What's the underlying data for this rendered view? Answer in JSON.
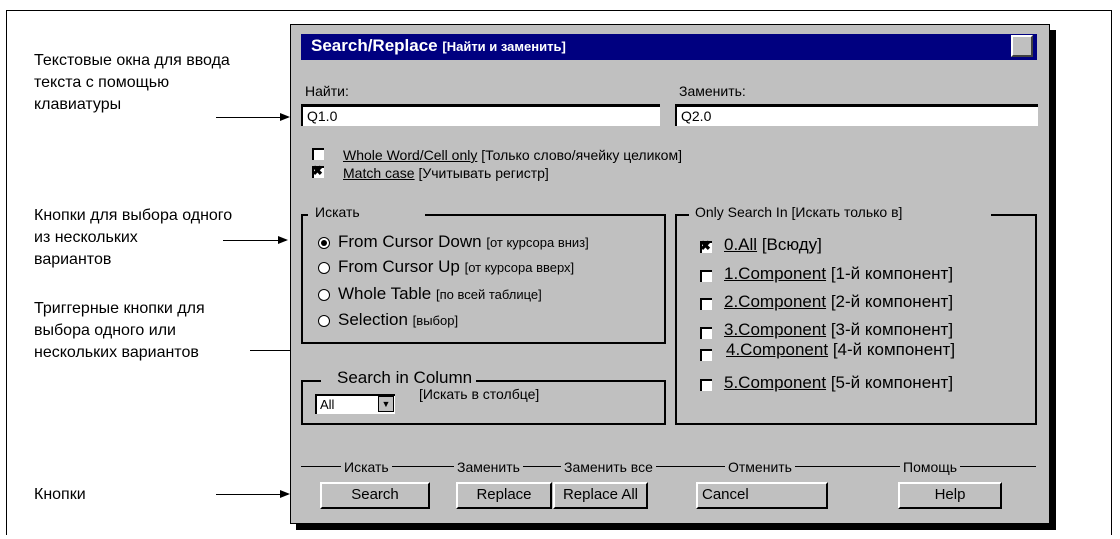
{
  "annotations": {
    "text_fields": "Текстовые окна для ввода\nтекста с помощью\nклавиатуры",
    "radio_buttons": "Кнопки для выбора одного\nиз нескольких\nвариантов",
    "check_buttons": "Триггерные кнопки для\nвыбора одного или\nнескольких вариантов",
    "buttons": "Кнопки"
  },
  "dialog": {
    "title": "Search/Replace",
    "title_ru": "[Найти и заменить]",
    "find_label": "Найти:",
    "find_value": "Q1.0",
    "replace_label": "Заменить:",
    "replace_value": "Q2.0",
    "whole_word": {
      "label": "Whole Word/Cell only",
      "ru": "[Только слово/ячейку целиком]",
      "checked": false
    },
    "match_case": {
      "label": "Match case",
      "ru": "[Учитывать регистр]",
      "checked": true
    },
    "search_group": {
      "legend": "Искать",
      "options": [
        {
          "label": "From Cursor Down",
          "ru": "[от курсора вниз]",
          "selected": true
        },
        {
          "label": "From Cursor Up",
          "ru": "[от курсора вверх]",
          "selected": false
        },
        {
          "label": "Whole Table",
          "ru": "[по всей таблице]",
          "selected": false
        },
        {
          "label": "Selection",
          "ru": "[выбор]",
          "selected": false
        }
      ]
    },
    "column_group": {
      "legend": "Search in Column",
      "ru": "[Искать в столбце]",
      "selected": "All"
    },
    "only_group": {
      "legend": "Only Search In [Искать только в]",
      "items": [
        {
          "label": "0.All",
          "ru": "[Всюду]",
          "checked": true
        },
        {
          "label": "1.Component",
          "ru": "[1-й компонент]",
          "checked": false
        },
        {
          "label": "2.Component",
          "ru": "[2-й компонент]",
          "checked": false
        },
        {
          "label": "3.Component",
          "ru": "[3-й компонент]",
          "checked": false
        },
        {
          "label": "4.Component",
          "ru": "[4-й компонент]",
          "checked": false
        },
        {
          "label": "5.Component",
          "ru": "[5-й компонент]",
          "checked": false
        }
      ]
    },
    "buttons": {
      "search": {
        "caption": "Искать",
        "label": "Search"
      },
      "replace": {
        "caption": "Заменить",
        "label": "Replace"
      },
      "replace_all": {
        "caption": "Заменить все",
        "label": "Replace All"
      },
      "cancel": {
        "caption": "Отменить",
        "label": "Cancel"
      },
      "help": {
        "caption": "Помощь",
        "label": "Help"
      }
    }
  }
}
